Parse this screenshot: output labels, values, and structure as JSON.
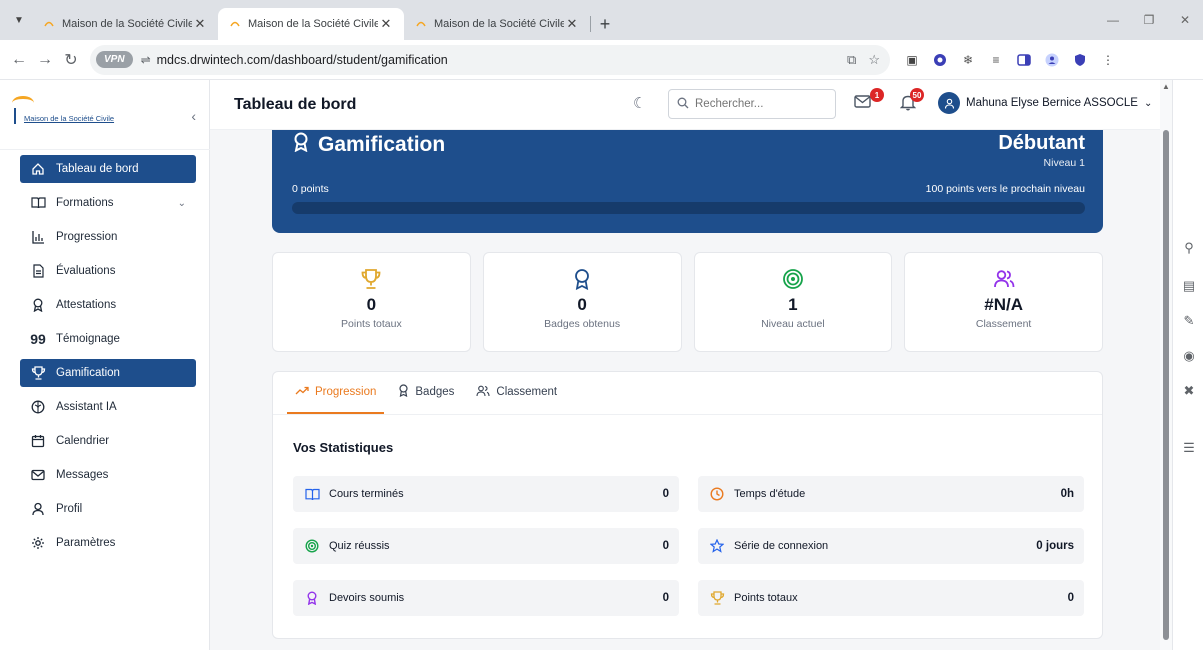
{
  "browser": {
    "tabs": [
      {
        "title": "Maison de la Société Civile - Pla",
        "active": false
      },
      {
        "title": "Maison de la Société Civile - Pla",
        "active": true
      },
      {
        "title": "Maison de la Société Civile - Pla",
        "active": false
      }
    ],
    "vpn_label": "VPN",
    "url": "mdcs.drwintech.com/dashboard/student/gamification"
  },
  "sidebar": {
    "logo_text": "Maison de la Société Civile",
    "items": [
      {
        "label": "Tableau de bord",
        "icon": "home-icon",
        "active": true
      },
      {
        "label": "Formations",
        "icon": "book-icon",
        "active": false,
        "has_submenu": true
      },
      {
        "label": "Progression",
        "icon": "bar-chart-icon",
        "active": false
      },
      {
        "label": "Évaluations",
        "icon": "document-icon",
        "active": false
      },
      {
        "label": "Attestations",
        "icon": "award-icon",
        "active": false
      },
      {
        "label": "Témoignage",
        "icon": "quote-icon",
        "active": false
      },
      {
        "label": "Gamification",
        "icon": "trophy-icon",
        "active": true
      },
      {
        "label": "Assistant IA",
        "icon": "brain-icon",
        "active": false
      },
      {
        "label": "Calendrier",
        "icon": "calendar-icon",
        "active": false
      },
      {
        "label": "Messages",
        "icon": "mail-icon",
        "active": false
      },
      {
        "label": "Profil",
        "icon": "user-icon",
        "active": false
      },
      {
        "label": "Paramètres",
        "icon": "gear-icon",
        "active": false
      }
    ]
  },
  "header": {
    "title": "Tableau de bord",
    "search_placeholder": "Rechercher...",
    "messages_count": "1",
    "notifications_count": "50",
    "user_name": "Mahuna Elyse Bernice ASSOCLE"
  },
  "hero": {
    "title": "Gamification",
    "level_name": "Débutant",
    "level_label": "Niveau 1",
    "points_label": "0 points",
    "next_level_label": "100 points vers le prochain niveau",
    "progress_fraction": 0
  },
  "stats": [
    {
      "value": "0",
      "label": "Points totaux",
      "icon": "trophy-icon",
      "color": "#e0a82e"
    },
    {
      "value": "0",
      "label": "Badges obtenus",
      "icon": "award-icon",
      "color": "#1e4e8c"
    },
    {
      "value": "1",
      "label": "Niveau actuel",
      "icon": "target-icon",
      "color": "#16a34a"
    },
    {
      "value": "#N/A",
      "label": "Classement",
      "icon": "users-icon",
      "color": "#9333ea"
    }
  ],
  "panel": {
    "tabs": [
      {
        "label": "Progression",
        "icon": "trend-up-icon",
        "active": true
      },
      {
        "label": "Badges",
        "icon": "award-icon",
        "active": false
      },
      {
        "label": "Classement",
        "icon": "users-icon",
        "active": false
      }
    ],
    "section_title": "Vos Statistiques",
    "rows": [
      {
        "label": "Cours terminés",
        "value": "0",
        "icon": "book-icon",
        "color": "#2563eb"
      },
      {
        "label": "Temps d'étude",
        "value": "0h",
        "icon": "clock-icon",
        "color": "#ea7a1f"
      },
      {
        "label": "Quiz réussis",
        "value": "0",
        "icon": "target-icon",
        "color": "#16a34a"
      },
      {
        "label": "Série de connexion",
        "value": "0 jours",
        "icon": "star-icon",
        "color": "#2563eb"
      },
      {
        "label": "Devoirs soumis",
        "value": "0",
        "icon": "award-icon",
        "color": "#9333ea"
      },
      {
        "label": "Points totaux",
        "value": "0",
        "icon": "trophy-icon",
        "color": "#e0a82e"
      }
    ]
  },
  "colors": {
    "primary": "#1e4e8c",
    "accent": "#ea7a1f",
    "badge": "#dc2626"
  }
}
